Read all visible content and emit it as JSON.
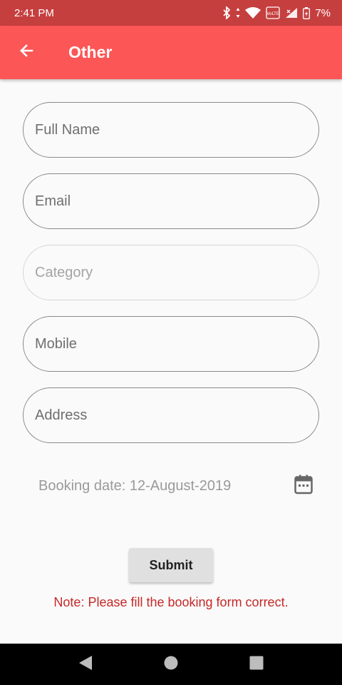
{
  "status_bar": {
    "time": "2:41 PM",
    "volte_label": "VoLTE",
    "battery": "7%"
  },
  "app_bar": {
    "title": "Other",
    "back_icon": "arrow-left-icon",
    "background": "#fc5656"
  },
  "form": {
    "full_name_placeholder": "Full Name",
    "email_placeholder": "Email",
    "category_placeholder": "Category",
    "mobile_placeholder": "Mobile",
    "address_placeholder": "Address",
    "booking_date_text": "Booking date: 12-August-2019",
    "calendar_icon": "calendar-icon",
    "submit_label": "Submit",
    "note": "Note: Please fill the booking form correct."
  },
  "nav_bar": {
    "back_icon": "triangle-back-icon",
    "home_icon": "circle-home-icon",
    "recents_icon": "square-recents-icon"
  }
}
